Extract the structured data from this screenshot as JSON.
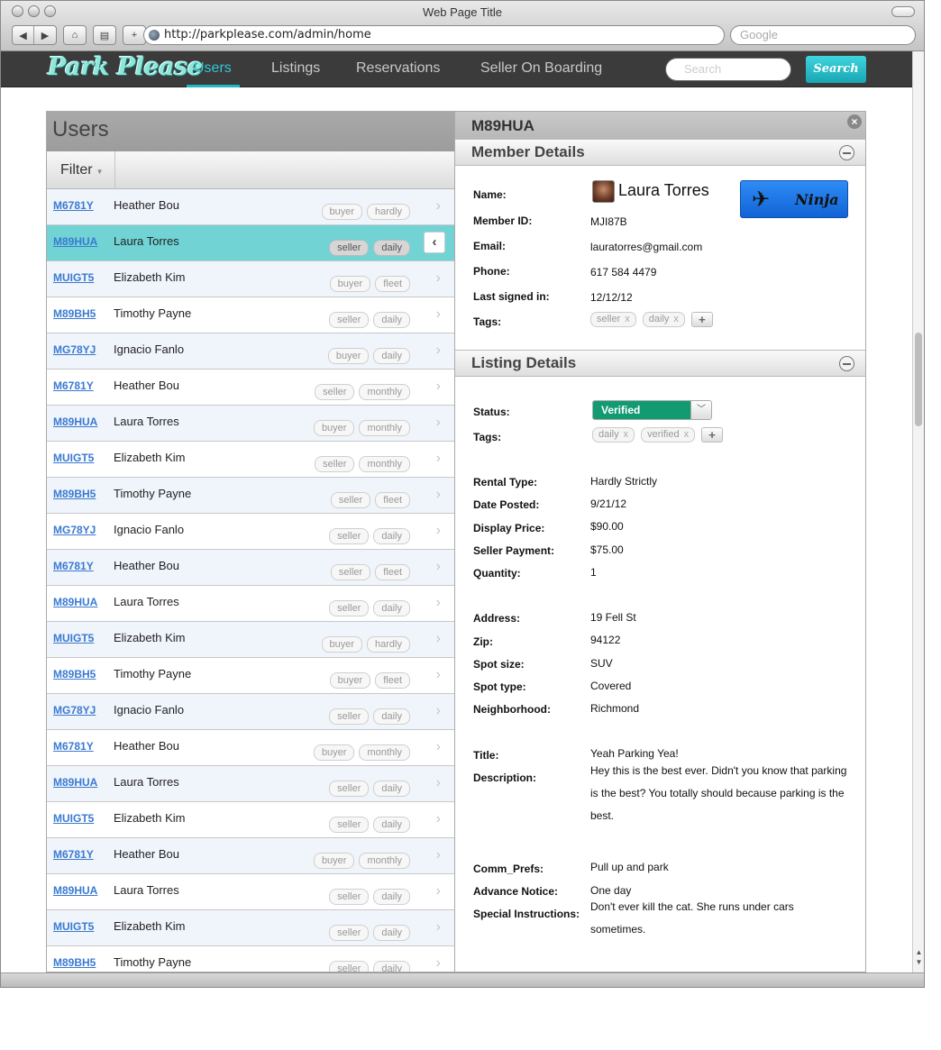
{
  "browser": {
    "window_title": "Web Page Title",
    "url": "http://parkplease.com/admin/home",
    "search_placeholder": "Google"
  },
  "app": {
    "logo": "Park Please",
    "nav": [
      "Users",
      "Listings",
      "Reservations",
      "Seller On Boarding"
    ],
    "active_nav": "Users",
    "search_placeholder": "Search",
    "search_button": "Search",
    "accent_color": "#21b8c6"
  },
  "users": {
    "title": "Users",
    "filter_label": "Filter",
    "selected_index": 1,
    "rows": [
      {
        "id": "M6781Y",
        "name": "Heather Bou",
        "tags": [
          "buyer",
          "hardly"
        ]
      },
      {
        "id": "M89HUA",
        "name": "Laura Torres",
        "tags": [
          "seller",
          "daily"
        ]
      },
      {
        "id": "MUIGT5",
        "name": "Elizabeth Kim",
        "tags": [
          "buyer",
          "fleet"
        ]
      },
      {
        "id": "M89BH5",
        "name": "Timothy Payne",
        "tags": [
          "seller",
          "daily"
        ]
      },
      {
        "id": "MG78YJ",
        "name": "Ignacio Fanlo",
        "tags": [
          "buyer",
          "daily"
        ]
      },
      {
        "id": "M6781Y",
        "name": "Heather Bou",
        "tags": [
          "seller",
          "monthly"
        ]
      },
      {
        "id": "M89HUA",
        "name": "Laura Torres",
        "tags": [
          "buyer",
          "monthly"
        ]
      },
      {
        "id": "MUIGT5",
        "name": "Elizabeth Kim",
        "tags": [
          "seller",
          "monthly"
        ]
      },
      {
        "id": "M89BH5",
        "name": "Timothy Payne",
        "tags": [
          "seller",
          "fleet"
        ]
      },
      {
        "id": "MG78YJ",
        "name": "Ignacio Fanlo",
        "tags": [
          "seller",
          "daily"
        ]
      },
      {
        "id": "M6781Y",
        "name": "Heather Bou",
        "tags": [
          "seller",
          "fleet"
        ]
      },
      {
        "id": "M89HUA",
        "name": "Laura Torres",
        "tags": [
          "seller",
          "daily"
        ]
      },
      {
        "id": "MUIGT5",
        "name": "Elizabeth Kim",
        "tags": [
          "buyer",
          "hardly"
        ]
      },
      {
        "id": "M89BH5",
        "name": "Timothy Payne",
        "tags": [
          "buyer",
          "fleet"
        ]
      },
      {
        "id": "MG78YJ",
        "name": "Ignacio Fanlo",
        "tags": [
          "seller",
          "daily"
        ]
      },
      {
        "id": "M6781Y",
        "name": "Heather Bou",
        "tags": [
          "buyer",
          "monthly"
        ]
      },
      {
        "id": "M89HUA",
        "name": "Laura Torres",
        "tags": [
          "seller",
          "daily"
        ]
      },
      {
        "id": "MUIGT5",
        "name": "Elizabeth Kim",
        "tags": [
          "seller",
          "daily"
        ]
      },
      {
        "id": "M6781Y",
        "name": "Heather Bou",
        "tags": [
          "buyer",
          "monthly"
        ]
      },
      {
        "id": "M89HUA",
        "name": "Laura Torres",
        "tags": [
          "seller",
          "daily"
        ]
      },
      {
        "id": "MUIGT5",
        "name": "Elizabeth Kim",
        "tags": [
          "seller",
          "daily"
        ]
      },
      {
        "id": "M89BH5",
        "name": "Timothy Payne",
        "tags": [
          "seller",
          "daily"
        ]
      }
    ]
  },
  "detail": {
    "title": "M89HUA",
    "member": {
      "section_title": "Member Details",
      "labels": {
        "name": "Name:",
        "member_id": "Member ID:",
        "email": "Email:",
        "phone": "Phone:",
        "last_signed_in": "Last signed in:",
        "tags": "Tags:"
      },
      "name": "Laura Torres",
      "member_id": "MJI87B",
      "email": "lauratorres@gmail.com",
      "phone": "617 584 4479",
      "last_signed_in": "12/12/12",
      "tags": [
        "seller",
        "daily"
      ],
      "badge": "Ninja"
    },
    "listing": {
      "section_title": "Listing Details",
      "labels": {
        "status": "Status:",
        "tags": "Tags:",
        "rental_type": "Rental Type:",
        "date_posted": "Date Posted:",
        "display_price": "Display Price:",
        "seller_payment": "Seller Payment:",
        "quantity": "Quantity:",
        "address": "Address:",
        "zip": "Zip:",
        "spot_size": "Spot size:",
        "spot_type": "Spot type:",
        "neighborhood": "Neighborhood:",
        "title": "Title:",
        "description": "Description:",
        "comm_prefs": "Comm_Prefs:",
        "advance_notice": "Advance Notice:",
        "special_instructions": "Special Instructions:"
      },
      "status": "Verified",
      "status_color": "#129b70",
      "tags": [
        "daily",
        "verified"
      ],
      "rental_type": "Hardly Strictly",
      "date_posted": "9/21/12",
      "display_price": "$90.00",
      "seller_payment": "$75.00",
      "quantity": "1",
      "address": "19 Fell St",
      "zip": "94122",
      "spot_size": "SUV",
      "spot_type": "Covered",
      "neighborhood": "Richmond",
      "title": "Yeah Parking Yea!",
      "description": "Hey this is the best ever. Didn't you know that parking is the best? You totally should because parking is the best.",
      "comm_prefs": "Pull up and park",
      "advance_notice": "One day",
      "special_instructions": "Don't ever kill the cat. She runs under cars sometimes."
    }
  }
}
